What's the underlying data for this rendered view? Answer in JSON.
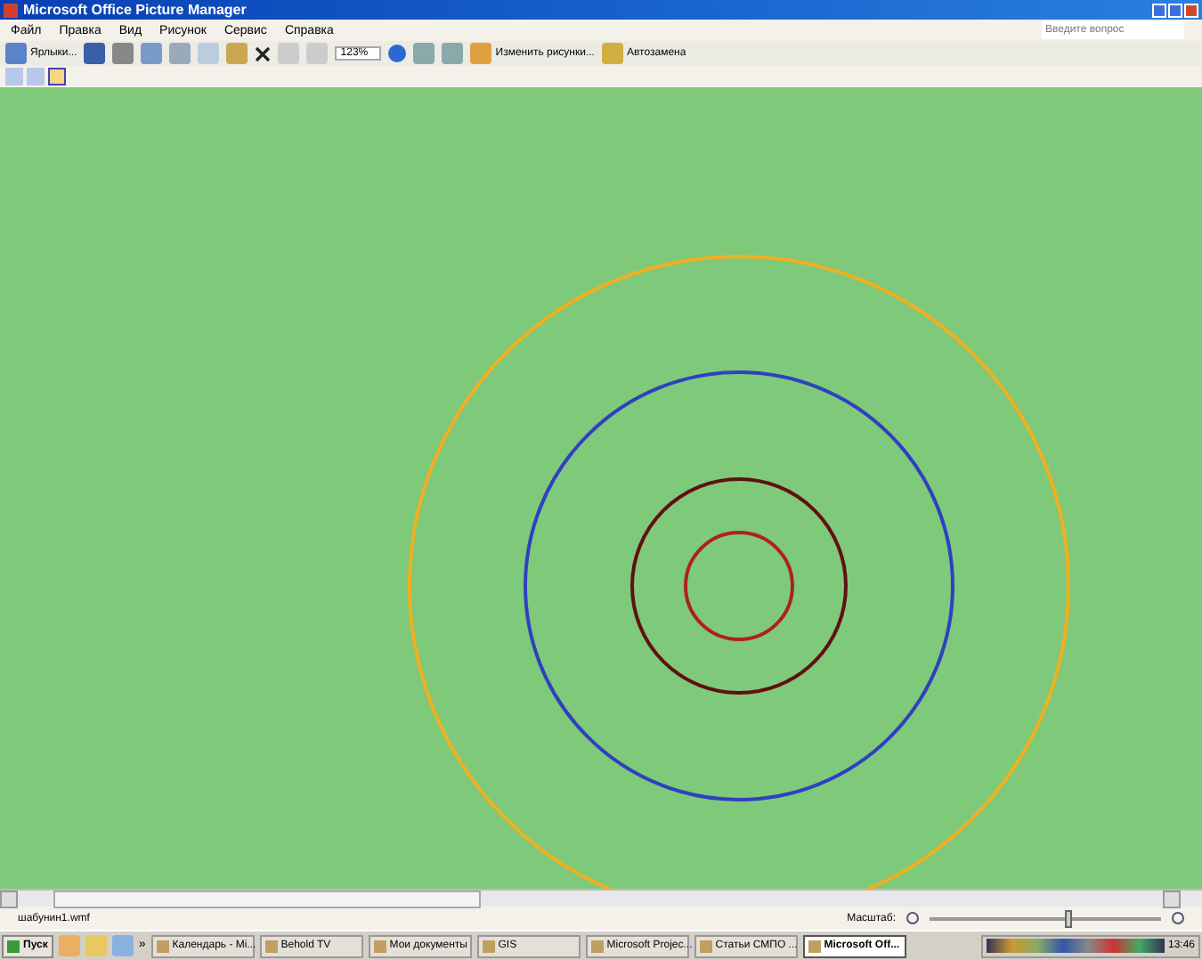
{
  "window": {
    "title": "Microsoft Office Picture Manager"
  },
  "menu": [
    "Файл",
    "Правка",
    "Вид",
    "Рисунок",
    "Сервис",
    "Справка"
  ],
  "help_search": {
    "placeholder": "Введите вопрос"
  },
  "toolbar": {
    "shortcuts_button": "Ярлыки...",
    "zoom": "123%",
    "edit_button": "Изменить рисунки...",
    "autocorrect_button": "Автозамена"
  },
  "view_buttons": [
    {
      "selected": false
    },
    {
      "selected": false
    },
    {
      "selected": true
    }
  ],
  "status_bar": {
    "file_name": "шабунин1.wmf",
    "zoom_label": "Масштаб:",
    "zoom_slider": {
      "level": 0.6
    }
  },
  "taskbar": {
    "start": "Пуск",
    "quick_more": "»",
    "tasks": [
      {
        "label": "Календарь - Mi...",
        "selected": false
      },
      {
        "label": "Behold TV",
        "selected": false
      },
      {
        "label": "Мои документы",
        "selected": false
      },
      {
        "label": "GIS",
        "selected": false
      },
      {
        "label": "Microsoft Projec...",
        "selected": false
      },
      {
        "label": "Статьи СМПО ...",
        "selected": false
      },
      {
        "label": "Microsoft Off...",
        "selected": true
      }
    ],
    "clock": "13:46"
  }
}
